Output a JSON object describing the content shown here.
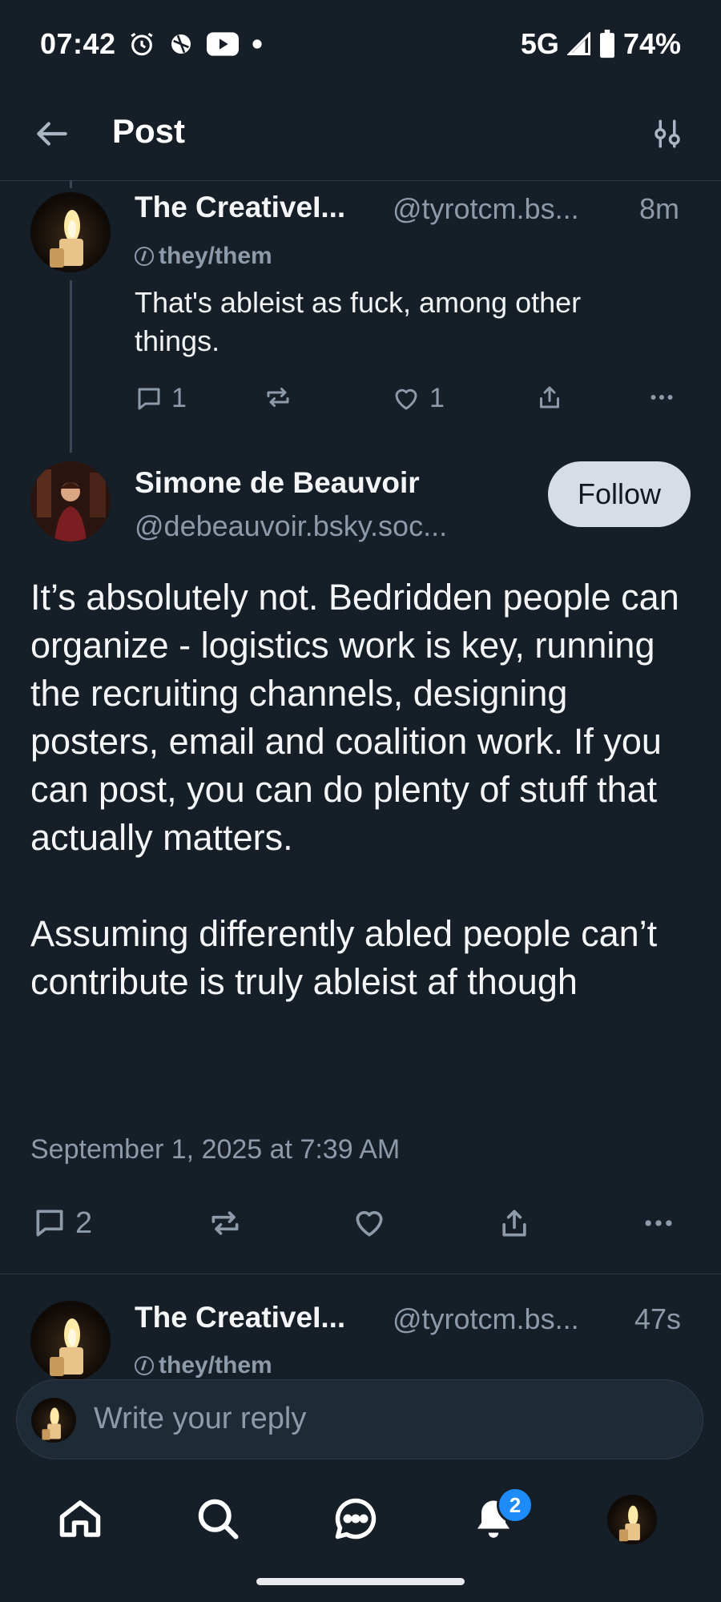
{
  "status_bar": {
    "time": "07:42",
    "network": "5G",
    "battery": "74%"
  },
  "header": {
    "title": "Post"
  },
  "parent_post": {
    "display_name": "The CreativeI...",
    "handle": "@tyrotcm.bs...",
    "time_ago": "8m",
    "pronouns": "they/them",
    "text": "That's ableist as fuck, among other things.",
    "reply_count": "1",
    "like_count": "1"
  },
  "main_post": {
    "display_name": "Simone de Beauvoir",
    "handle": "@debeauvoir.bsky.soc...",
    "follow_label": "Follow",
    "text": "It’s absolutely not. Bedridden people can organize - logistics work is key, running the recruiting channels, designing posters, email and coalition work. If you can post, you can do plenty of stuff that actually matters.\n\nAssuming differently abled people can’t contribute is truly ableist af though",
    "date": "September 1, 2025 at 7:39 AM",
    "reply_count": "2"
  },
  "next_reply": {
    "display_name": "The CreativeI...",
    "handle": "@tyrotcm.bs...",
    "time_ago": "47s",
    "pronouns": "they/them"
  },
  "composer": {
    "placeholder": "Write your reply"
  },
  "bottom_nav": {
    "notification_badge": "2"
  },
  "colors": {
    "background": "#161e27",
    "accent": "#1d8cf8",
    "muted": "#8d9aaa"
  }
}
